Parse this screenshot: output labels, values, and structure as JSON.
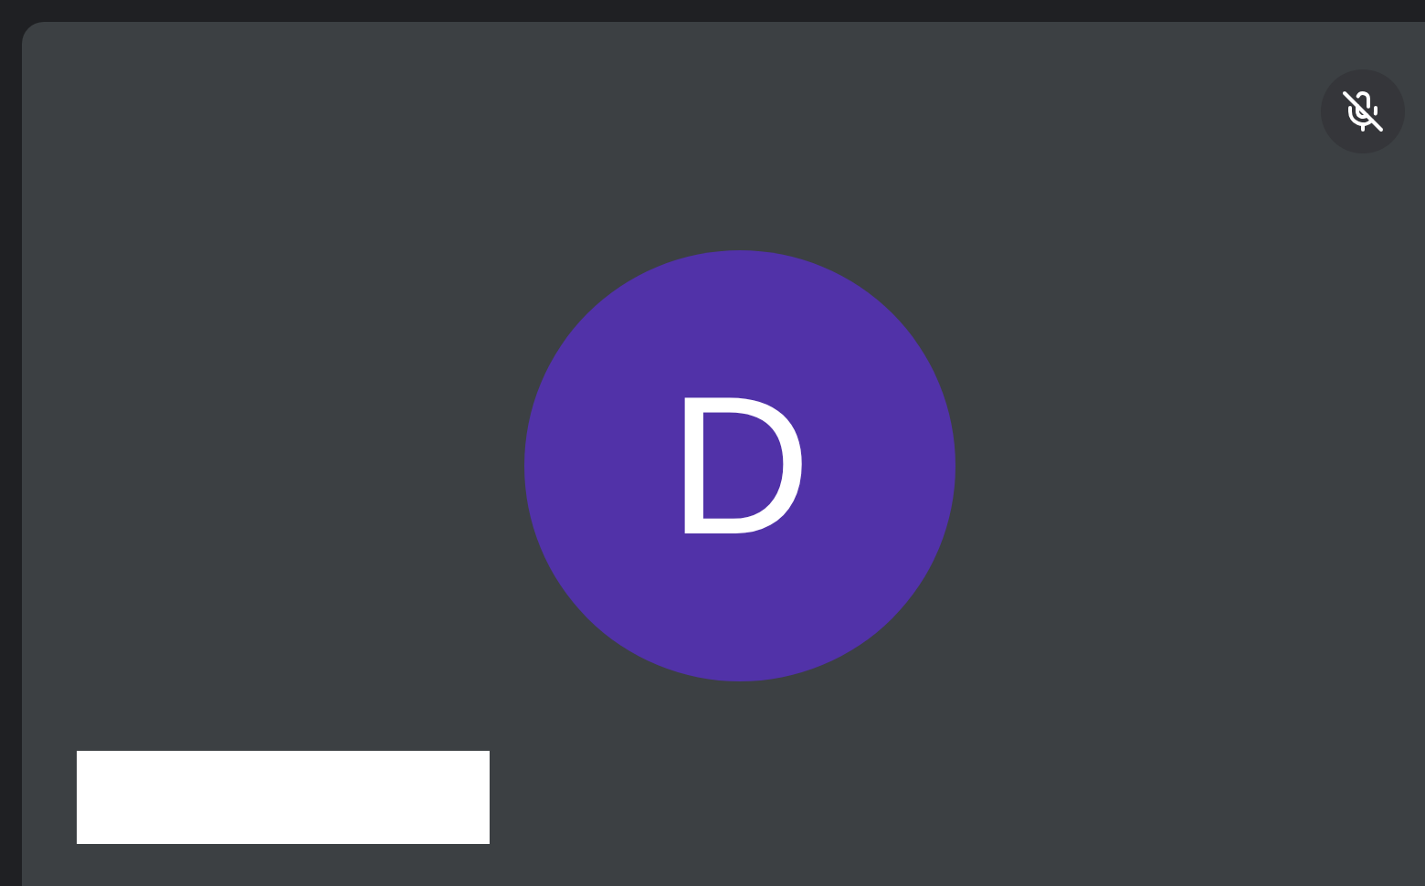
{
  "tile": {
    "muted": true,
    "avatar": {
      "initial": "D"
    }
  }
}
